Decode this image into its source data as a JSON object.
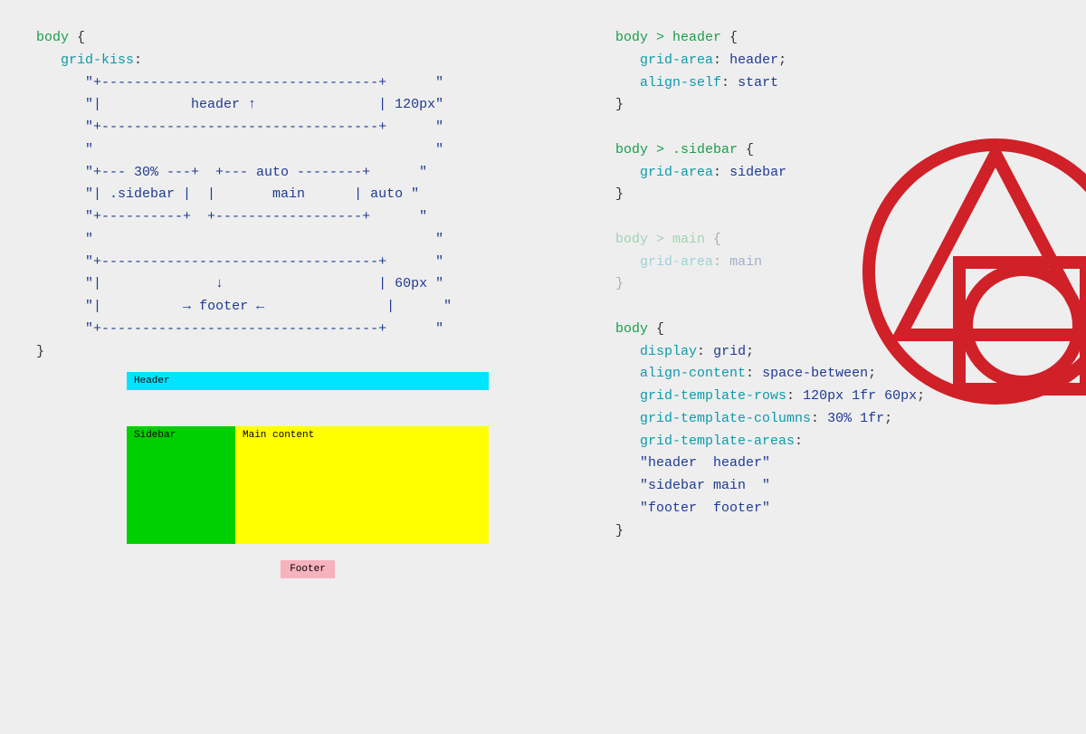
{
  "left": {
    "selector": "body",
    "prop": "grid-kiss",
    "ascii": {
      "l1": "\"+----------------------------------+      \"",
      "l2a": "\"|           header ",
      "l2b": "↑",
      "l2c": "               | 120px\"",
      "l3": "\"+----------------------------------+      \"",
      "l4": "\"                                          \"",
      "l5": "\"+--- 30% ---+  +--- auto --------+      \"",
      "l6": "\"| .sidebar |  |       main      | auto \"",
      "l7": "\"+----------+  +------------------+      \"",
      "l8": "\"                                          \"",
      "l9": "\"+----------------------------------+      \"",
      "l10a": "\"|              ",
      "l10b": "↓",
      "l10c": "                   | 60px \"",
      "l11a": "\"|          ",
      "l11b": "→",
      "l11c": " footer ",
      "l11d": "←",
      "l11e": "               |      \"",
      "l12": "\"+----------------------------------+      \""
    }
  },
  "right": {
    "block1": {
      "selector": "body > header",
      "p1": "grid-area",
      "v1": "header",
      "p2": "align-self",
      "v2": "start"
    },
    "block2": {
      "selector": "body > .sidebar",
      "p1": "grid-area",
      "v1": "sidebar"
    },
    "block3": {
      "selector": "body > main",
      "p1": "grid-area",
      "v1": "main"
    },
    "block4": {
      "selector": "body",
      "p1": "display",
      "v1": "grid",
      "p2": "align-content",
      "v2": "space-between",
      "p3": "grid-template-rows",
      "v3": "120px 1fr 60px",
      "p4": "grid-template-columns",
      "v4": "30% 1fr",
      "p5": "grid-template-areas",
      "a1": "\"header  header\"",
      "a2": "\"sidebar main  \"",
      "a3": "\"footer  footer\""
    }
  },
  "demo": {
    "header": "Header",
    "sidebar": "Sidebar",
    "main": "Main content",
    "footer": "Footer"
  }
}
